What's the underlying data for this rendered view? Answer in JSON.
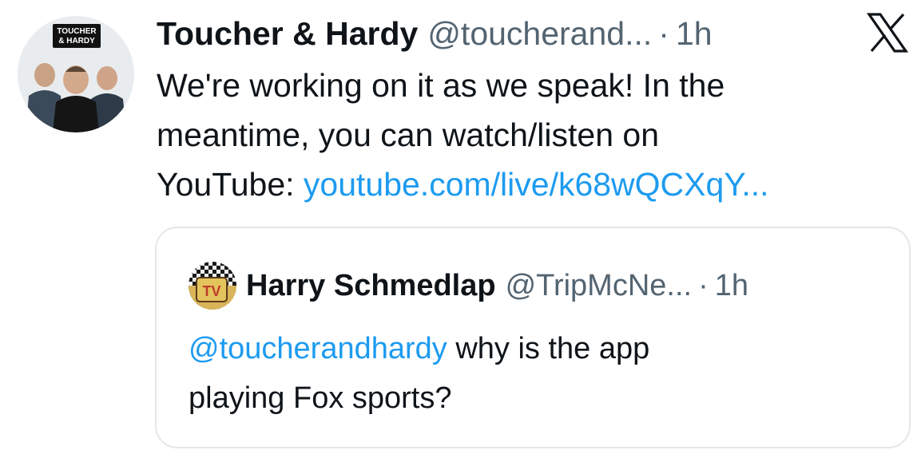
{
  "tweet": {
    "author": {
      "display_name": "Toucher & Hardy",
      "handle": "@toucherand...",
      "separator": "·",
      "time": "1h",
      "avatar_logo_line1": "TOUCHER",
      "avatar_logo_line2": "& HARDY"
    },
    "text": {
      "line1": "We're working on it as we speak! In the",
      "line2": "meantime, you can watch/listen on",
      "line3_prefix": "YouTube: ",
      "link": "youtube.com/live/k68wQCXqY..."
    },
    "close_icon": "x-logo-icon"
  },
  "quoted_tweet": {
    "author": {
      "display_name": "Harry Schmedlap",
      "handle": "@TripMcNe...",
      "separator": "·",
      "time": "1h",
      "avatar_logo": "TV"
    },
    "text": {
      "mention": "@toucherandhardy",
      "line1_rest": " why is the app",
      "line2": "playing Fox sports?"
    }
  },
  "colors": {
    "link": "#1d9bf0",
    "secondary_text": "#536471",
    "primary_text": "#0f1419",
    "border": "#e3e7ea"
  }
}
